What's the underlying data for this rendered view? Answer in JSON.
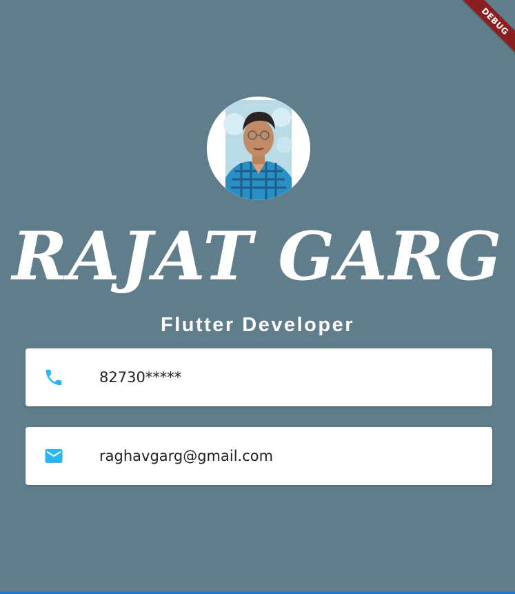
{
  "debug_banner": {
    "label": "DEBUG"
  },
  "profile": {
    "name": "RAJAT GARG",
    "title": "Flutter Developer"
  },
  "contacts": {
    "phone": {
      "icon": "phone-icon",
      "value": "82730*****"
    },
    "email": {
      "icon": "mail-icon",
      "value": "raghavgarg@gmail.com"
    }
  },
  "colors": {
    "background": "#607d8b",
    "card": "#ffffff",
    "icon": "#29b6f6",
    "debug_banner": "#8b1e1e"
  }
}
